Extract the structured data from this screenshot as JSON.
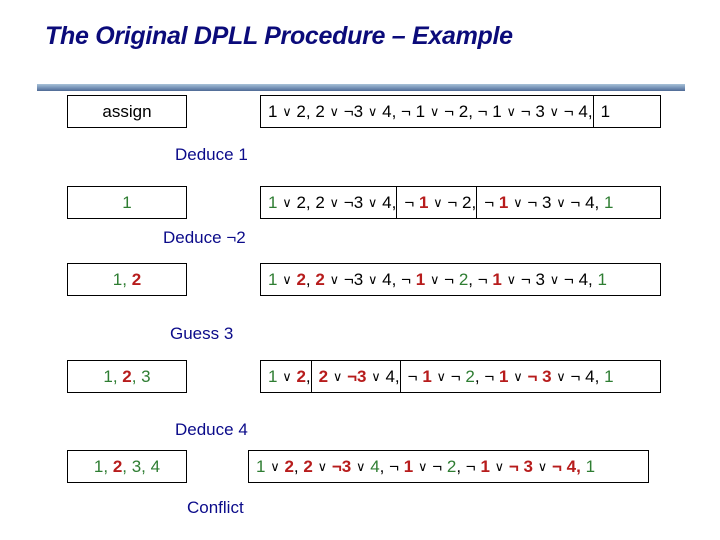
{
  "title": "The Original DPLL Procedure – Example",
  "colors": {
    "title": "#0b0b7a",
    "label": "#0b0b8a",
    "true_literal": "#2e7d32",
    "false_literal": "#b71c1c",
    "neutral": "#000000"
  },
  "rows": [
    {
      "assignment": [
        {
          "t": "assign",
          "c": "black"
        }
      ],
      "clauses": [
        [
          {
            "t": "1 ",
            "c": "black"
          },
          {
            "t": "∨",
            "c": "black",
            "op": true
          },
          {
            "t": " 2, 2 ",
            "c": "black"
          },
          {
            "t": "∨",
            "c": "black",
            "op": true
          },
          {
            "t": " ¬3 ",
            "c": "black"
          },
          {
            "t": "∨",
            "c": "black",
            "op": true
          },
          {
            "t": " 4, ¬ 1 ",
            "c": "black"
          },
          {
            "t": "∨",
            "c": "black",
            "op": true
          },
          {
            "t": " ¬ 2, ¬ 1 ",
            "c": "black"
          },
          {
            "t": "∨",
            "c": "black",
            "op": true
          },
          {
            "t": " ¬ 3 ",
            "c": "black"
          },
          {
            "t": "∨",
            "c": "black",
            "op": true
          },
          {
            "t": " ¬ 4,",
            "c": "black"
          }
        ],
        [
          {
            "t": "1",
            "c": "black"
          }
        ]
      ],
      "label_after": "Deduce 1"
    },
    {
      "assignment": [
        {
          "t": "1",
          "c": "green"
        }
      ],
      "clauses": [
        [
          {
            "t": "1",
            "c": "green"
          },
          {
            "t": " ",
            "c": "black"
          },
          {
            "t": "∨",
            "c": "black",
            "op": true
          },
          {
            "t": " 2, 2 ",
            "c": "black"
          },
          {
            "t": "∨",
            "c": "black",
            "op": true
          },
          {
            "t": " ¬3 ",
            "c": "black"
          },
          {
            "t": "∨",
            "c": "black",
            "op": true
          },
          {
            "t": " 4,",
            "c": "black"
          }
        ],
        [
          {
            "t": "¬ ",
            "c": "black"
          },
          {
            "t": "1",
            "c": "red"
          },
          {
            "t": " ",
            "c": "black"
          },
          {
            "t": "∨",
            "c": "black",
            "op": true
          },
          {
            "t": " ¬ 2,",
            "c": "black"
          }
        ],
        [
          {
            "t": "¬ ",
            "c": "black"
          },
          {
            "t": "1",
            "c": "red"
          },
          {
            "t": " ",
            "c": "black"
          },
          {
            "t": "∨",
            "c": "black",
            "op": true
          },
          {
            "t": " ¬ 3 ",
            "c": "black"
          },
          {
            "t": "∨",
            "c": "black",
            "op": true
          },
          {
            "t": " ¬ 4, ",
            "c": "black"
          },
          {
            "t": "1",
            "c": "green"
          }
        ]
      ],
      "label_after": "Deduce ¬2"
    },
    {
      "assignment": [
        {
          "t": "1",
          "c": "green"
        },
        {
          "t": ", ",
          "c": "green"
        },
        {
          "t": "2",
          "c": "red"
        }
      ],
      "clauses": [
        [
          {
            "t": "1",
            "c": "green"
          },
          {
            "t": " ",
            "c": "black"
          },
          {
            "t": "∨",
            "c": "black",
            "op": true
          },
          {
            "t": " ",
            "c": "black"
          },
          {
            "t": "2",
            "c": "red"
          },
          {
            "t": ", ",
            "c": "black"
          },
          {
            "t": "2",
            "c": "red"
          },
          {
            "t": " ",
            "c": "black"
          },
          {
            "t": "∨",
            "c": "black",
            "op": true
          },
          {
            "t": " ¬3 ",
            "c": "black"
          },
          {
            "t": "∨",
            "c": "black",
            "op": true
          },
          {
            "t": " 4, ¬ ",
            "c": "black"
          },
          {
            "t": "1",
            "c": "red"
          },
          {
            "t": " ",
            "c": "black"
          },
          {
            "t": "∨",
            "c": "black",
            "op": true
          },
          {
            "t": " ¬ ",
            "c": "black"
          },
          {
            "t": "2",
            "c": "green"
          },
          {
            "t": ", ¬ ",
            "c": "black"
          },
          {
            "t": "1",
            "c": "red"
          },
          {
            "t": " ",
            "c": "black"
          },
          {
            "t": "∨",
            "c": "black",
            "op": true
          },
          {
            "t": " ¬ 3 ",
            "c": "black"
          },
          {
            "t": "∨",
            "c": "black",
            "op": true
          },
          {
            "t": " ¬ 4, ",
            "c": "black"
          },
          {
            "t": "1",
            "c": "green"
          }
        ]
      ],
      "label_after": "Guess 3"
    },
    {
      "assignment": [
        {
          "t": "1, ",
          "c": "green"
        },
        {
          "t": "2",
          "c": "red"
        },
        {
          "t": ", 3",
          "c": "green"
        }
      ],
      "clauses": [
        [
          {
            "t": "1",
            "c": "green"
          },
          {
            "t": " ",
            "c": "black"
          },
          {
            "t": "∨",
            "c": "black",
            "op": true
          },
          {
            "t": " ",
            "c": "black"
          },
          {
            "t": "2",
            "c": "red"
          },
          {
            "t": ",",
            "c": "black"
          }
        ],
        [
          {
            "t": "2",
            "c": "red"
          },
          {
            "t": " ",
            "c": "black"
          },
          {
            "t": "∨",
            "c": "black",
            "op": true
          },
          {
            "t": " ",
            "c": "black"
          },
          {
            "t": "¬3",
            "c": "red"
          },
          {
            "t": " ",
            "c": "black"
          },
          {
            "t": "∨",
            "c": "black",
            "op": true
          },
          {
            "t": " 4,",
            "c": "black"
          }
        ],
        [
          {
            "t": "¬ ",
            "c": "black"
          },
          {
            "t": "1",
            "c": "red"
          },
          {
            "t": " ",
            "c": "black"
          },
          {
            "t": "∨",
            "c": "black",
            "op": true
          },
          {
            "t": " ¬ ",
            "c": "black"
          },
          {
            "t": "2",
            "c": "green"
          },
          {
            "t": ", ¬ ",
            "c": "black"
          },
          {
            "t": "1",
            "c": "red"
          },
          {
            "t": " ",
            "c": "black"
          },
          {
            "t": "∨",
            "c": "black",
            "op": true
          },
          {
            "t": " ",
            "c": "black"
          },
          {
            "t": "¬ 3",
            "c": "red"
          },
          {
            "t": " ",
            "c": "black"
          },
          {
            "t": "∨",
            "c": "black",
            "op": true
          },
          {
            "t": " ¬ 4, ",
            "c": "black"
          },
          {
            "t": "1",
            "c": "green"
          }
        ]
      ],
      "label_after": "Deduce 4"
    },
    {
      "assignment": [
        {
          "t": "1, ",
          "c": "green"
        },
        {
          "t": "2",
          "c": "red"
        },
        {
          "t": ", 3, 4",
          "c": "green"
        }
      ],
      "clauses": [
        [
          {
            "t": "1",
            "c": "green"
          },
          {
            "t": " ",
            "c": "black"
          },
          {
            "t": "∨",
            "c": "black",
            "op": true
          },
          {
            "t": " ",
            "c": "black"
          },
          {
            "t": "2",
            "c": "red"
          },
          {
            "t": ", ",
            "c": "black"
          },
          {
            "t": "2",
            "c": "red"
          },
          {
            "t": " ",
            "c": "black"
          },
          {
            "t": "∨",
            "c": "black",
            "op": true
          },
          {
            "t": " ",
            "c": "black"
          },
          {
            "t": "¬3",
            "c": "red"
          },
          {
            "t": " ",
            "c": "black"
          },
          {
            "t": "∨",
            "c": "black",
            "op": true
          },
          {
            "t": " ",
            "c": "black"
          },
          {
            "t": "4",
            "c": "green"
          },
          {
            "t": ", ¬ ",
            "c": "black"
          },
          {
            "t": "1",
            "c": "red"
          },
          {
            "t": " ",
            "c": "black"
          },
          {
            "t": "∨",
            "c": "black",
            "op": true
          },
          {
            "t": " ¬ ",
            "c": "black"
          },
          {
            "t": "2",
            "c": "green"
          },
          {
            "t": ", ¬ ",
            "c": "black"
          },
          {
            "t": "1",
            "c": "red"
          },
          {
            "t": " ",
            "c": "black"
          },
          {
            "t": "∨",
            "c": "black",
            "op": true
          },
          {
            "t": " ",
            "c": "black"
          },
          {
            "t": "¬ 3",
            "c": "red"
          },
          {
            "t": " ",
            "c": "black"
          },
          {
            "t": "∨",
            "c": "black",
            "op": true
          },
          {
            "t": " ",
            "c": "black"
          },
          {
            "t": "¬ 4,",
            "c": "red"
          },
          {
            "t": " ",
            "c": "black"
          },
          {
            "t": "1",
            "c": "green"
          }
        ]
      ],
      "label_after": "Conflict"
    }
  ]
}
